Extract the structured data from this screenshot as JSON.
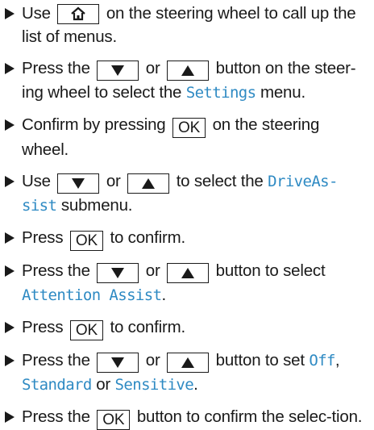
{
  "steps": [
    {
      "before": "Use",
      "key_icon": "home-icon",
      "after": "on the steering wheel to call up the list of menus."
    },
    {
      "before": "Press the",
      "key_down": "down-arrow-icon",
      "or": "or",
      "key_up": "up-arrow-icon",
      "middle": "button on the steer-ing wheel to select the",
      "term": "Settings",
      "after": "menu."
    },
    {
      "before": "Confirm by pressing",
      "key": "OK",
      "after": "on the steering wheel."
    },
    {
      "before": "Use",
      "key_down": "down-arrow-icon",
      "or": "or",
      "key_up": "up-arrow-icon",
      "middle": "to select the",
      "term": "DriveAs-sist",
      "after": "submenu."
    },
    {
      "before": "Press",
      "key": "OK",
      "after": "to confirm."
    },
    {
      "before": "Press the",
      "key_down": "down-arrow-icon",
      "or": "or",
      "key_up": "up-arrow-icon",
      "middle": "button to select",
      "term": "Attention Assist",
      "after": "."
    },
    {
      "before": "Press",
      "key": "OK",
      "after": "to confirm."
    },
    {
      "before": "Press the",
      "key_down": "down-arrow-icon",
      "or": "or",
      "key_up": "up-arrow-icon",
      "middle": "button to set",
      "term1": "Off",
      "sep1": ",",
      "term2": "Standard",
      "sep2": "or",
      "term3": "Sensitive",
      "after": "."
    },
    {
      "before": "Press the",
      "key": "OK",
      "after": "button to confirm the selec-tion."
    }
  ],
  "colors": {
    "text": "#1a1a1a",
    "term": "#2e8ac3"
  }
}
